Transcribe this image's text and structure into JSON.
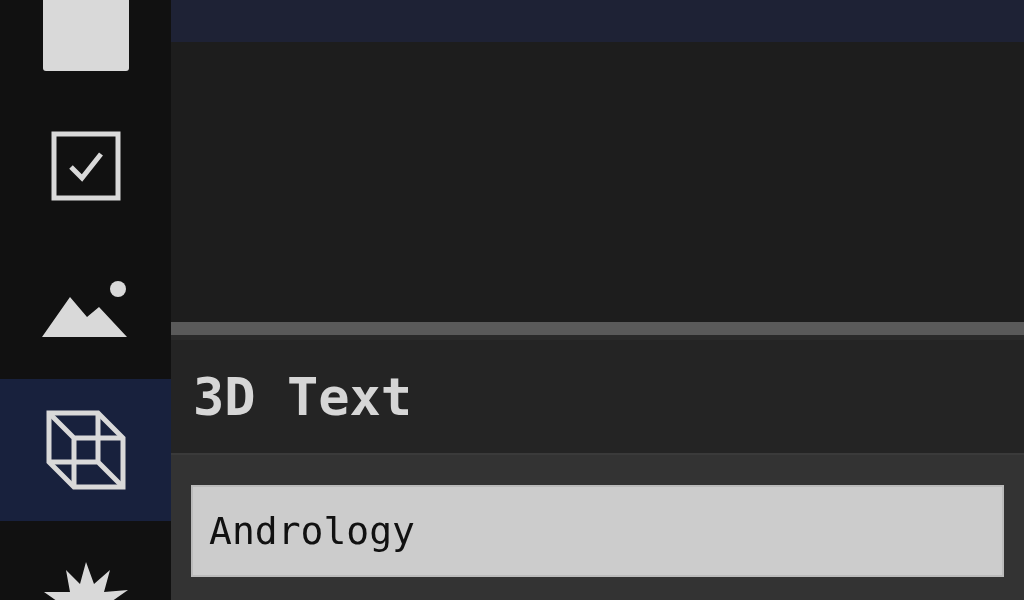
{
  "sidebar": {
    "items": [
      {
        "kind": "square",
        "selected": false
      },
      {
        "kind": "checkbox",
        "selected": false
      },
      {
        "kind": "image",
        "selected": false
      },
      {
        "kind": "cube",
        "selected": true
      },
      {
        "kind": "burst",
        "selected": false
      }
    ]
  },
  "panel": {
    "title": "3D Text",
    "field": {
      "value": "Andrology"
    }
  }
}
